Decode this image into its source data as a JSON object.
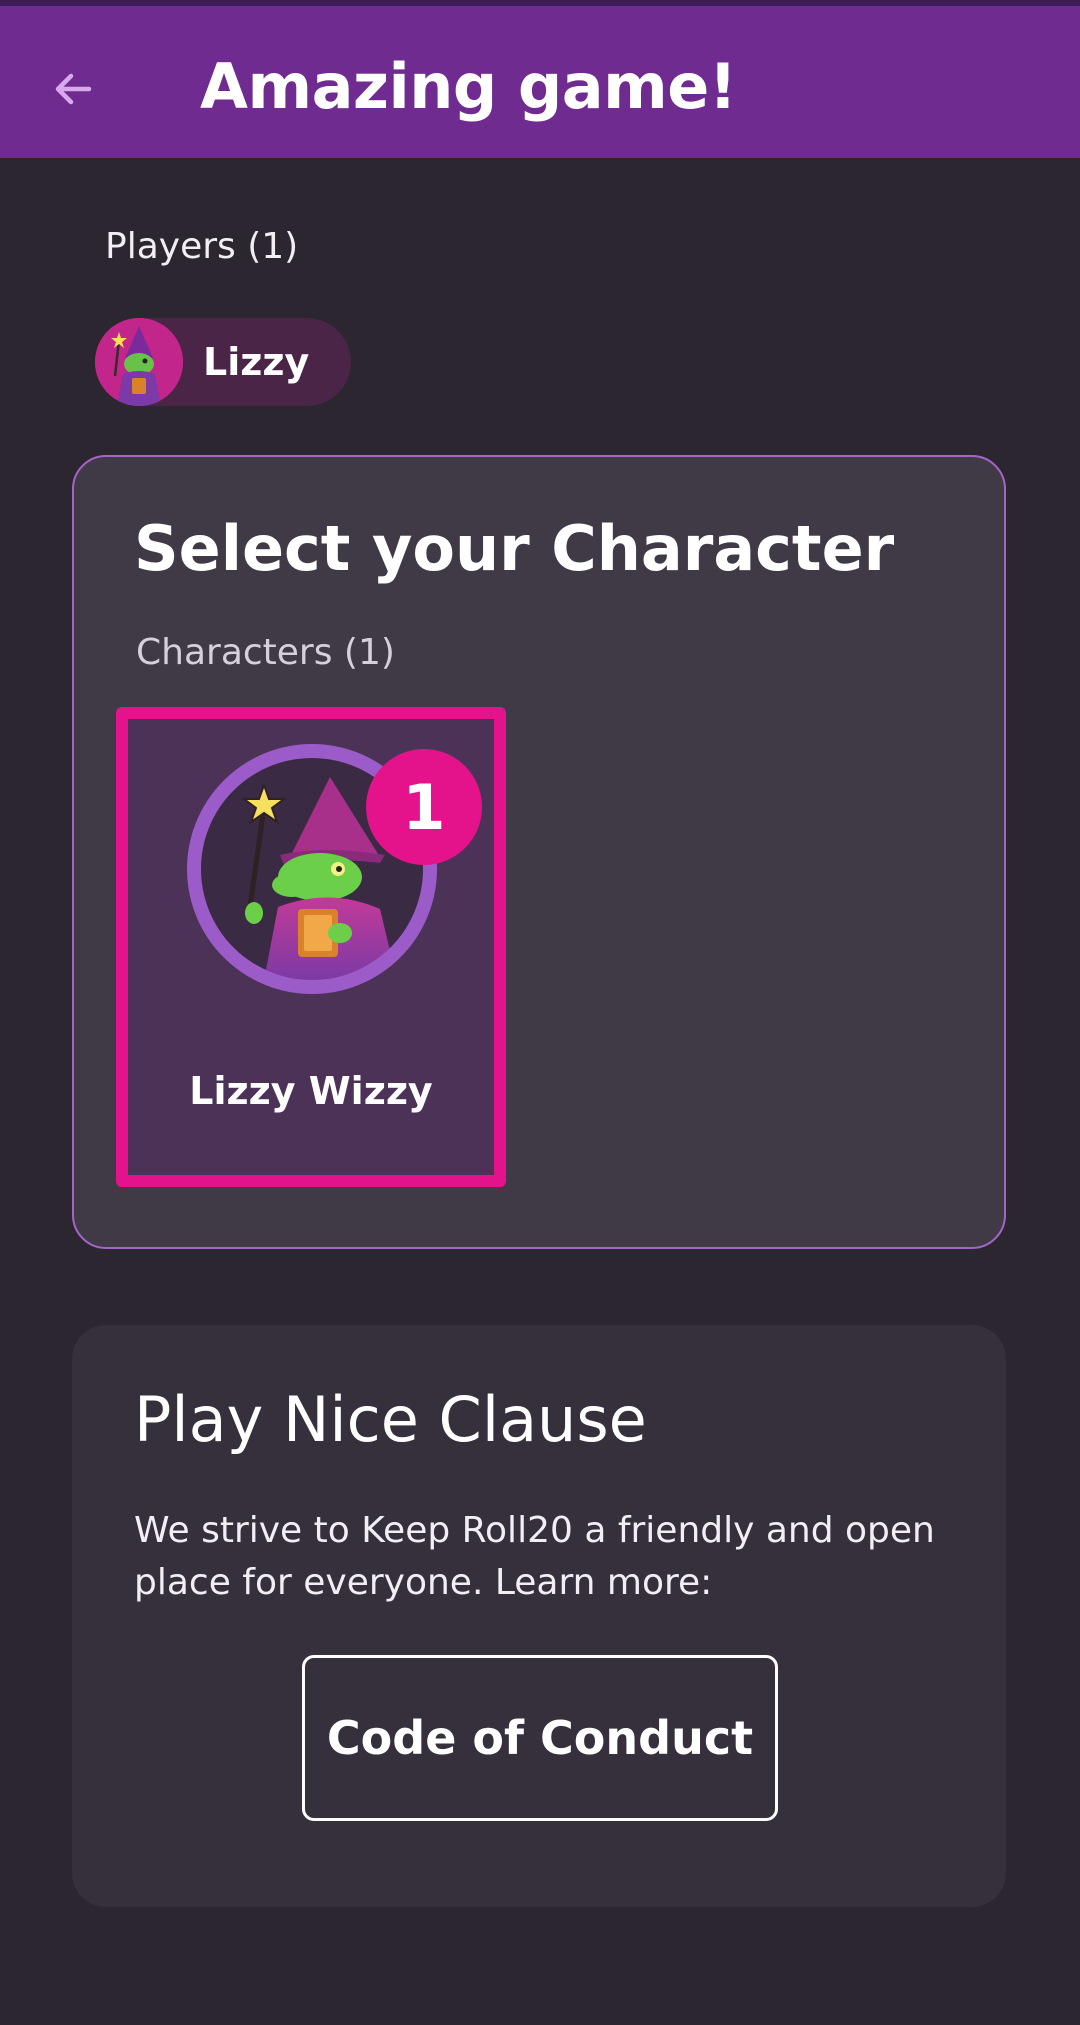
{
  "header": {
    "title": "Amazing game!",
    "back_icon": "arrow-left-icon"
  },
  "players": {
    "label": "Players (1)",
    "list": [
      {
        "name": "Lizzy",
        "avatar_icon": "lizard-wizard-avatar"
      }
    ]
  },
  "character_select": {
    "title": "Select your Character",
    "characters_label": "Characters (1)",
    "characters": [
      {
        "name": "Lizzy Wizzy",
        "badge": "1",
        "selected": true,
        "avatar_icon": "lizard-wizard-avatar"
      }
    ]
  },
  "play_nice": {
    "title": "Play Nice Clause",
    "body": "We strive to Keep Roll20 a friendly and open place for everyone. Learn more:",
    "button_label": "Code of Conduct"
  },
  "colors": {
    "appbar": "#6f2b8f",
    "background": "#2b2630",
    "card": "#403a47",
    "card_border": "#a565c8",
    "accent_pink": "#e5138b"
  }
}
